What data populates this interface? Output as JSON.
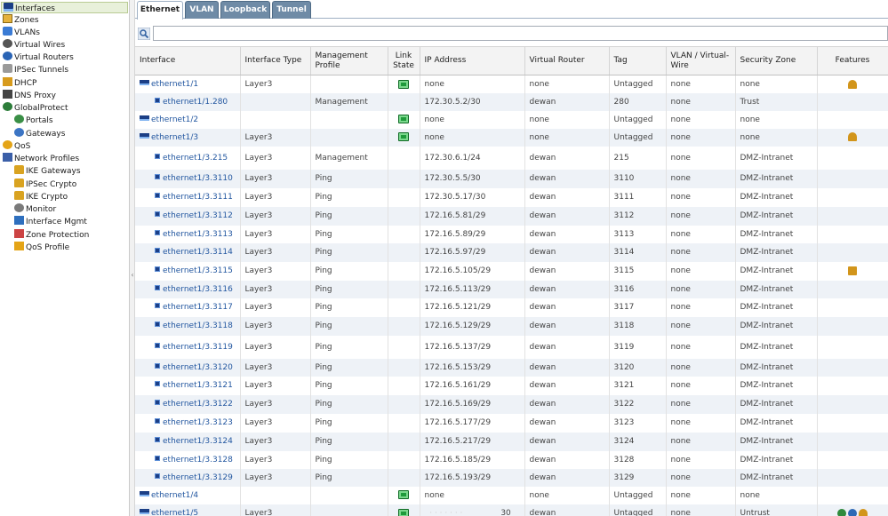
{
  "sidebar": {
    "items": [
      {
        "label": "Interfaces",
        "icon": "interfaces-icon"
      },
      {
        "label": "Zones",
        "icon": "zones-icon"
      },
      {
        "label": "VLANs",
        "icon": "vlans-icon"
      },
      {
        "label": "Virtual Wires",
        "icon": "virtual-wires-icon"
      },
      {
        "label": "Virtual Routers",
        "icon": "virtual-routers-icon"
      },
      {
        "label": "IPSec Tunnels",
        "icon": "ipsec-tunnels-icon"
      },
      {
        "label": "DHCP",
        "icon": "dhcp-icon"
      },
      {
        "label": "DNS Proxy",
        "icon": "dns-proxy-icon"
      },
      {
        "label": "GlobalProtect",
        "icon": "globalprotect-icon"
      },
      {
        "label": "Portals",
        "icon": "portals-icon"
      },
      {
        "label": "Gateways",
        "icon": "gateways-icon"
      },
      {
        "label": "QoS",
        "icon": "qos-icon"
      },
      {
        "label": "Network Profiles",
        "icon": "network-profiles-icon"
      },
      {
        "label": "IKE Gateways",
        "icon": "ike-gateways-icon"
      },
      {
        "label": "IPSec Crypto",
        "icon": "ipsec-crypto-icon"
      },
      {
        "label": "IKE Crypto",
        "icon": "ike-crypto-icon"
      },
      {
        "label": "Monitor",
        "icon": "monitor-icon"
      },
      {
        "label": "Interface Mgmt",
        "icon": "interface-mgmt-icon"
      },
      {
        "label": "Zone Protection",
        "icon": "zone-protection-icon"
      },
      {
        "label": "QoS Profile",
        "icon": "qos-profile-icon"
      }
    ]
  },
  "tabs": [
    "Ethernet",
    "VLAN",
    "Loopback",
    "Tunnel"
  ],
  "search": {
    "value": "",
    "placeholder": ""
  },
  "splitter_glyph": "‹",
  "columns": {
    "interface": "Interface",
    "interface_type": "Interface Type",
    "management_profile": "Management Profile",
    "link_state": "Link State",
    "ip_address": "IP Address",
    "virtual_router": "Virtual Router",
    "tag": "Tag",
    "vlan_vwire": "VLAN / Virtual-Wire",
    "security_zone": "Security Zone",
    "features": "Features"
  },
  "rows": [
    {
      "interface": "ethernet1/1",
      "type": "Layer3",
      "mgmt": "",
      "link": true,
      "ip": "none",
      "vr": "none",
      "tag": "Untagged",
      "vlan": "none",
      "zone": "none",
      "features": [
        "dhcp"
      ],
      "sub": false
    },
    {
      "interface": "ethernet1/1.280",
      "type": "",
      "mgmt": "Management",
      "link": false,
      "ip": "172.30.5.2/30",
      "vr": "dewan",
      "tag": "280",
      "vlan": "none",
      "zone": "Trust",
      "features": [],
      "sub": true
    },
    {
      "interface": "ethernet1/2",
      "type": "",
      "mgmt": "",
      "link": true,
      "ip": "none",
      "vr": "none",
      "tag": "Untagged",
      "vlan": "none",
      "zone": "none",
      "features": [],
      "sub": false
    },
    {
      "interface": "ethernet1/3",
      "type": "Layer3",
      "mgmt": "",
      "link": true,
      "ip": "none",
      "vr": "none",
      "tag": "Untagged",
      "vlan": "none",
      "zone": "none",
      "features": [
        "dhcp"
      ],
      "sub": false
    },
    {
      "interface": "ethernet1/3.215",
      "type": "Layer3",
      "mgmt": "Management",
      "link": false,
      "ip": "172.30.6.1/24",
      "vr": "dewan",
      "tag": "215",
      "vlan": "none",
      "zone": "DMZ-Intranet",
      "features": [],
      "sub": true
    },
    {
      "interface": "ethernet1/3.3110",
      "type": "Layer3",
      "mgmt": "Ping",
      "link": false,
      "ip": "172.30.5.5/30",
      "vr": "dewan",
      "tag": "3110",
      "vlan": "none",
      "zone": "DMZ-Intranet",
      "features": [],
      "sub": true
    },
    {
      "interface": "ethernet1/3.3111",
      "type": "Layer3",
      "mgmt": "Ping",
      "link": false,
      "ip": "172.30.5.17/30",
      "vr": "dewan",
      "tag": "3111",
      "vlan": "none",
      "zone": "DMZ-Intranet",
      "features": [],
      "sub": true
    },
    {
      "interface": "ethernet1/3.3112",
      "type": "Layer3",
      "mgmt": "Ping",
      "link": false,
      "ip": "172.16.5.81/29",
      "vr": "dewan",
      "tag": "3112",
      "vlan": "none",
      "zone": "DMZ-Intranet",
      "features": [],
      "sub": true
    },
    {
      "interface": "ethernet1/3.3113",
      "type": "Layer3",
      "mgmt": "Ping",
      "link": false,
      "ip": "172.16.5.89/29",
      "vr": "dewan",
      "tag": "3113",
      "vlan": "none",
      "zone": "DMZ-Intranet",
      "features": [],
      "sub": true
    },
    {
      "interface": "ethernet1/3.3114",
      "type": "Layer3",
      "mgmt": "Ping",
      "link": false,
      "ip": "172.16.5.97/29",
      "vr": "dewan",
      "tag": "3114",
      "vlan": "none",
      "zone": "DMZ-Intranet",
      "features": [],
      "sub": true
    },
    {
      "interface": "ethernet1/3.3115",
      "type": "Layer3",
      "mgmt": "Ping",
      "link": false,
      "ip": "172.16.5.105/29",
      "vr": "dewan",
      "tag": "3115",
      "vlan": "none",
      "zone": "DMZ-Intranet",
      "features": [
        "ip"
      ],
      "sub": true
    },
    {
      "interface": "ethernet1/3.3116",
      "type": "Layer3",
      "mgmt": "Ping",
      "link": false,
      "ip": "172.16.5.113/29",
      "vr": "dewan",
      "tag": "3116",
      "vlan": "none",
      "zone": "DMZ-Intranet",
      "features": [],
      "sub": true
    },
    {
      "interface": "ethernet1/3.3117",
      "type": "Layer3",
      "mgmt": "Ping",
      "link": false,
      "ip": "172.16.5.121/29",
      "vr": "dewan",
      "tag": "3117",
      "vlan": "none",
      "zone": "DMZ-Intranet",
      "features": [],
      "sub": true
    },
    {
      "interface": "ethernet1/3.3118",
      "type": "Layer3",
      "mgmt": "Ping",
      "link": false,
      "ip": "172.16.5.129/29",
      "vr": "dewan",
      "tag": "3118",
      "vlan": "none",
      "zone": "DMZ-Intranet",
      "features": [],
      "sub": true
    },
    {
      "interface": "ethernet1/3.3119",
      "type": "Layer3",
      "mgmt": "Ping",
      "link": false,
      "ip": "172.16.5.137/29",
      "vr": "dewan",
      "tag": "3119",
      "vlan": "none",
      "zone": "DMZ-Intranet",
      "features": [],
      "sub": true
    },
    {
      "interface": "ethernet1/3.3120",
      "type": "Layer3",
      "mgmt": "Ping",
      "link": false,
      "ip": "172.16.5.153/29",
      "vr": "dewan",
      "tag": "3120",
      "vlan": "none",
      "zone": "DMZ-Intranet",
      "features": [],
      "sub": true
    },
    {
      "interface": "ethernet1/3.3121",
      "type": "Layer3",
      "mgmt": "Ping",
      "link": false,
      "ip": "172.16.5.161/29",
      "vr": "dewan",
      "tag": "3121",
      "vlan": "none",
      "zone": "DMZ-Intranet",
      "features": [],
      "sub": true
    },
    {
      "interface": "ethernet1/3.3122",
      "type": "Layer3",
      "mgmt": "Ping",
      "link": false,
      "ip": "172.16.5.169/29",
      "vr": "dewan",
      "tag": "3122",
      "vlan": "none",
      "zone": "DMZ-Intranet",
      "features": [],
      "sub": true
    },
    {
      "interface": "ethernet1/3.3123",
      "type": "Layer3",
      "mgmt": "Ping",
      "link": false,
      "ip": "172.16.5.177/29",
      "vr": "dewan",
      "tag": "3123",
      "vlan": "none",
      "zone": "DMZ-Intranet",
      "features": [],
      "sub": true
    },
    {
      "interface": "ethernet1/3.3124",
      "type": "Layer3",
      "mgmt": "Ping",
      "link": false,
      "ip": "172.16.5.217/29",
      "vr": "dewan",
      "tag": "3124",
      "vlan": "none",
      "zone": "DMZ-Intranet",
      "features": [],
      "sub": true
    },
    {
      "interface": "ethernet1/3.3128",
      "type": "Layer3",
      "mgmt": "Ping",
      "link": false,
      "ip": "172.16.5.185/29",
      "vr": "dewan",
      "tag": "3128",
      "vlan": "none",
      "zone": "DMZ-Intranet",
      "features": [],
      "sub": true
    },
    {
      "interface": "ethernet1/3.3129",
      "type": "Layer3",
      "mgmt": "Ping",
      "link": false,
      "ip": "172.16.5.193/29",
      "vr": "dewan",
      "tag": "3129",
      "vlan": "none",
      "zone": "DMZ-Intranet",
      "features": [],
      "sub": true
    },
    {
      "interface": "ethernet1/4",
      "type": "",
      "mgmt": "",
      "link": true,
      "ip": "none",
      "vr": "none",
      "tag": "Untagged",
      "vlan": "none",
      "zone": "none",
      "features": [],
      "sub": false
    },
    {
      "interface": "ethernet1/5",
      "type": "Layer3",
      "mgmt": "",
      "link": true,
      "ip": "30",
      "vr": "dewan",
      "tag": "Untagged",
      "vlan": "none",
      "zone": "Untrust",
      "features": [
        "gp",
        "globe",
        "dhcp"
      ],
      "sub": false
    }
  ],
  "colors": {
    "tab_inactive": "#6f8ba6",
    "row_alt": "#eef2f7",
    "link": "#2357a0",
    "sidebar_selected": "#e8f0da",
    "link_state_up": "#1f9a3b"
  }
}
